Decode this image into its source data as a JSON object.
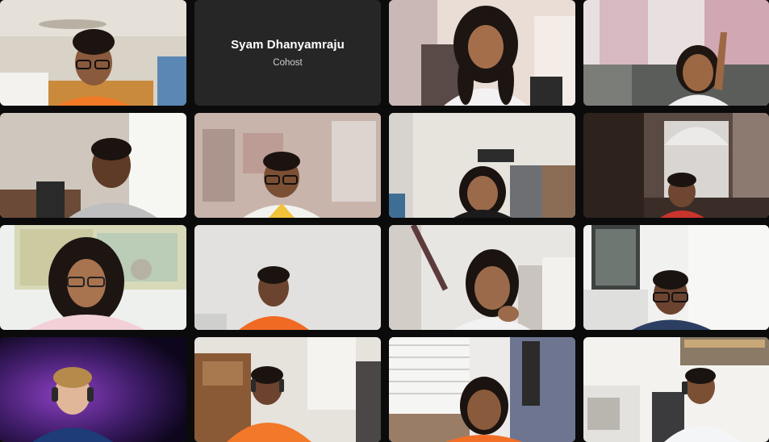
{
  "meeting": {
    "participants": [
      {
        "id": "p1",
        "video_on": true
      },
      {
        "id": "p2",
        "video_on": false,
        "name": "Syam Dhanyamraju",
        "role": "Cohost"
      },
      {
        "id": "p3",
        "video_on": true
      },
      {
        "id": "p4",
        "video_on": true
      },
      {
        "id": "p5",
        "video_on": true
      },
      {
        "id": "p6",
        "video_on": true
      },
      {
        "id": "p7",
        "video_on": true
      },
      {
        "id": "p8",
        "video_on": true
      },
      {
        "id": "p9",
        "video_on": true
      },
      {
        "id": "p10",
        "video_on": true
      },
      {
        "id": "p11",
        "video_on": true
      },
      {
        "id": "p12",
        "video_on": true
      },
      {
        "id": "p13",
        "video_on": true
      },
      {
        "id": "p14",
        "video_on": true
      },
      {
        "id": "p15",
        "video_on": true
      },
      {
        "id": "p16",
        "video_on": true
      }
    ]
  },
  "colors": {
    "background": "#0b0b0b",
    "name_card": "#262626",
    "name_text": "#ffffff",
    "role_text": "#cfcfcf"
  }
}
